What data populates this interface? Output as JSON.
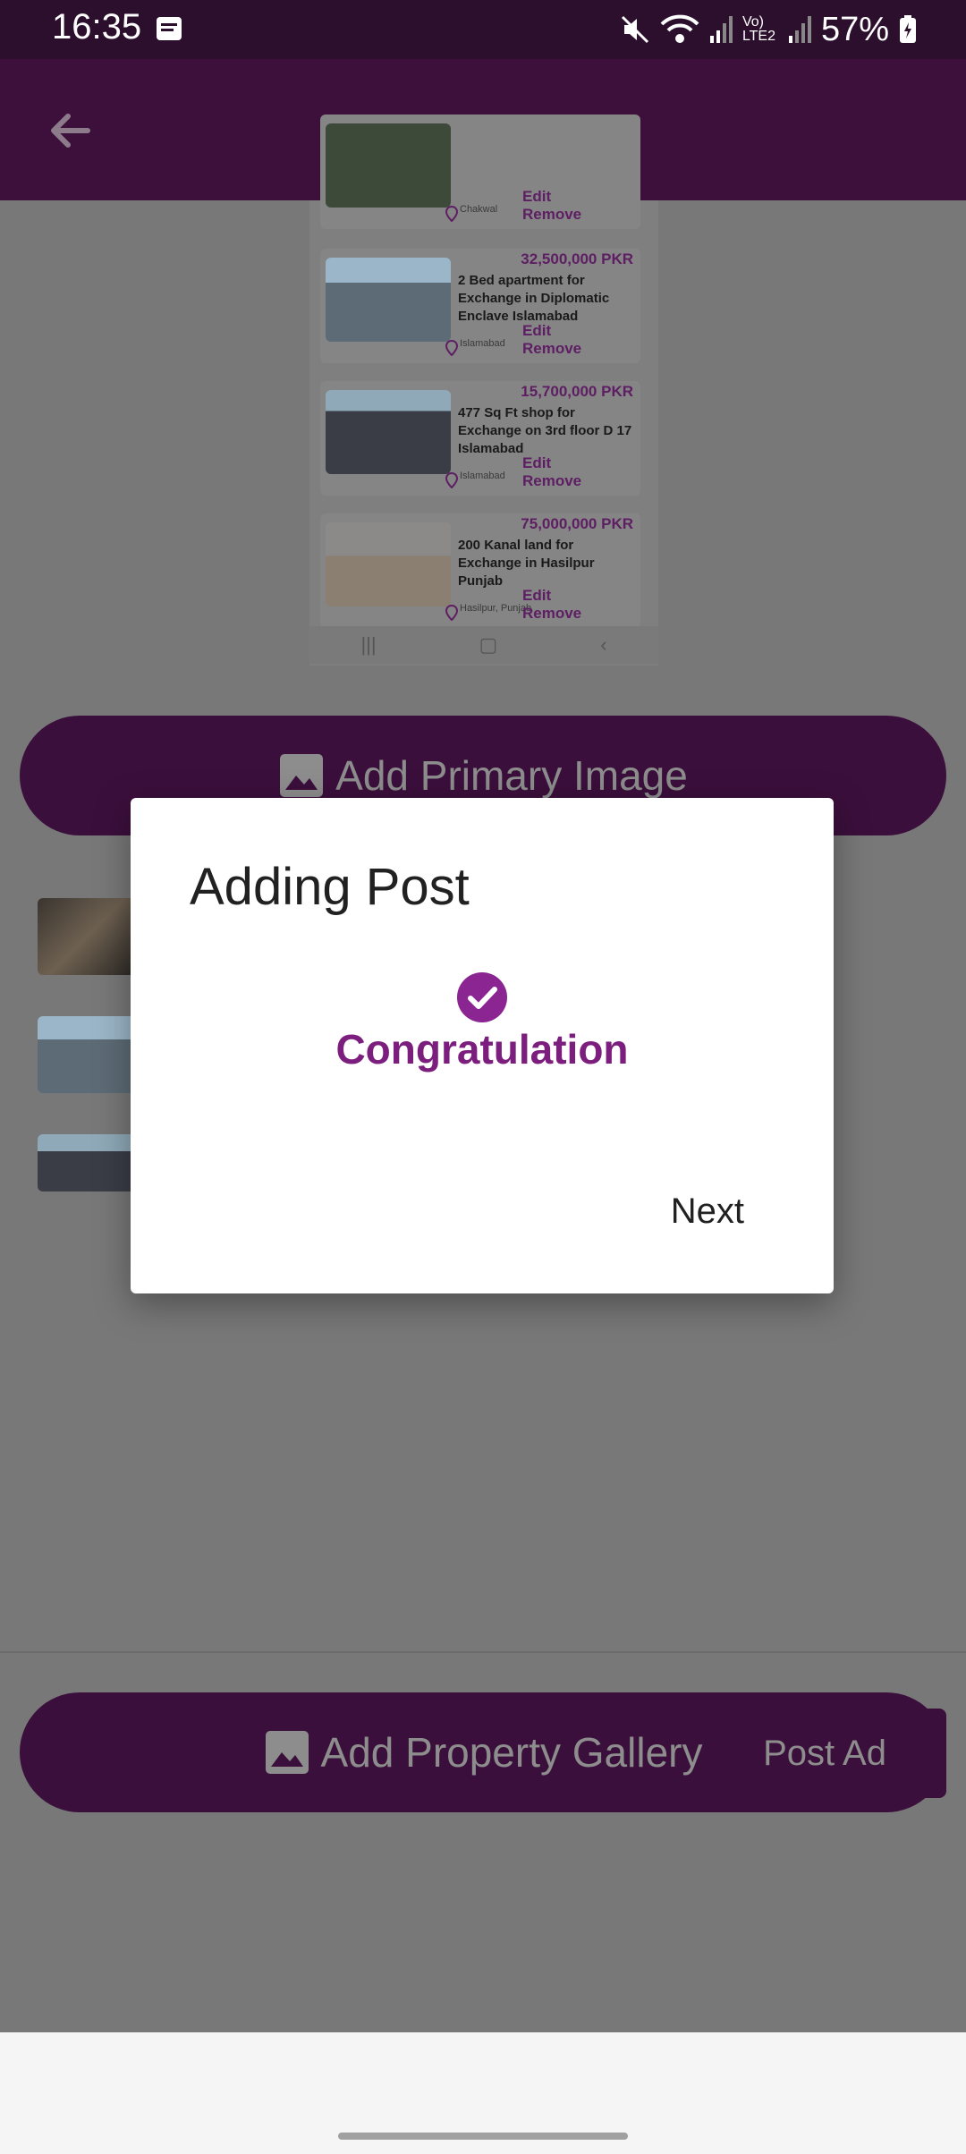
{
  "status_bar": {
    "time": "16:35",
    "network": "Vo) LTE2",
    "battery": "57%"
  },
  "preview_list": {
    "items": [
      {
        "price": "",
        "title": "",
        "location": "Chakwal",
        "edit": "Edit",
        "remove": "Remove"
      },
      {
        "price": "32,500,000 PKR",
        "title": "2 Bed apartment for Exchange in Diplomatic Enclave Islamabad",
        "location": "Islamabad",
        "edit": "Edit",
        "remove": "Remove"
      },
      {
        "price": "15,700,000 PKR",
        "title": "477 Sq Ft shop for Exchange on 3rd floor D 17 Islamabad",
        "location": "Islamabad",
        "edit": "Edit",
        "remove": "Remove"
      },
      {
        "price": "75,000,000 PKR",
        "title": "200 Kanal land for Exchange in Hasilpur Punjab",
        "location": "Hasilpur, Punjab",
        "edit": "Edit",
        "remove": "Remove"
      }
    ]
  },
  "buttons": {
    "add_primary_image": "Add Primary Image",
    "add_property_gallery": "Add Property Gallery",
    "post_ad": "Post Ad"
  },
  "dialog": {
    "title": "Adding Post",
    "message": "Congratulation",
    "next": "Next"
  },
  "colors": {
    "brand": "#3b0f3c",
    "accent": "#7b1e7e"
  }
}
